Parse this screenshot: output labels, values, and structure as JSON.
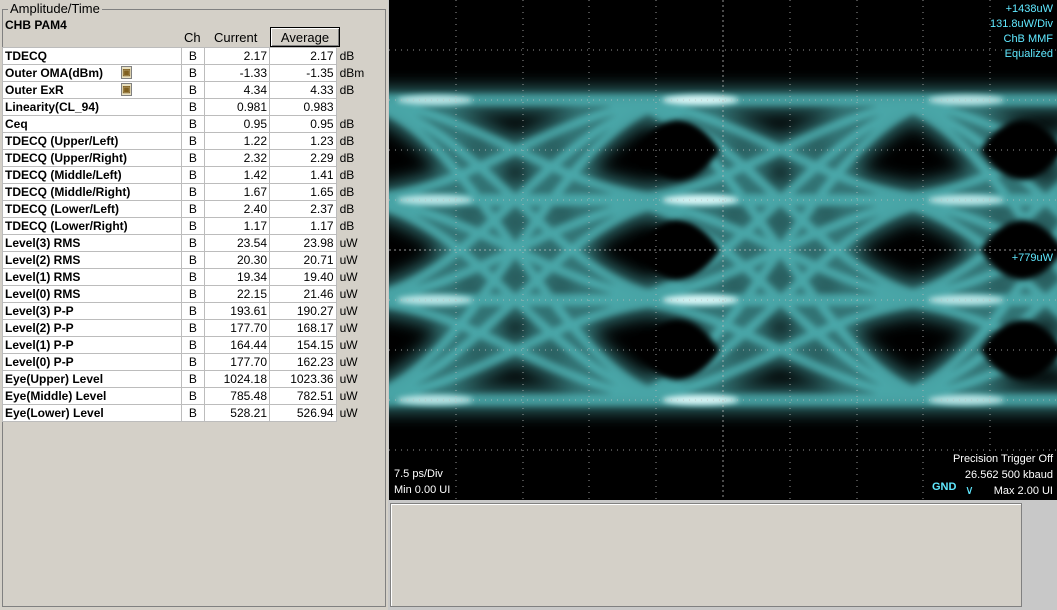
{
  "panel": {
    "title": "Amplitude/Time",
    "subtitle": "CHB PAM4",
    "col_ch": "Ch",
    "col_current": "Current",
    "average_button": "Average",
    "rows": [
      {
        "name": "TDECQ",
        "ch": "B",
        "current": "2.17",
        "average": "2.17",
        "unit": "dB",
        "lock": false
      },
      {
        "name": "Outer OMA(dBm)",
        "ch": "B",
        "current": "-1.33",
        "average": "-1.35",
        "unit": "dBm",
        "lock": true
      },
      {
        "name": "Outer ExR",
        "ch": "B",
        "current": "4.34",
        "average": "4.33",
        "unit": "dB",
        "lock": true
      },
      {
        "name": "Linearity(CL_94)",
        "ch": "B",
        "current": "0.981",
        "average": "0.983",
        "unit": "",
        "lock": false
      },
      {
        "name": "Ceq",
        "ch": "B",
        "current": "0.95",
        "average": "0.95",
        "unit": "dB",
        "lock": false
      },
      {
        "name": "TDECQ (Upper/Left)",
        "ch": "B",
        "current": "1.22",
        "average": "1.23",
        "unit": "dB",
        "lock": false
      },
      {
        "name": "TDECQ (Upper/Right)",
        "ch": "B",
        "current": "2.32",
        "average": "2.29",
        "unit": "dB",
        "lock": false
      },
      {
        "name": "TDECQ (Middle/Left)",
        "ch": "B",
        "current": "1.42",
        "average": "1.41",
        "unit": "dB",
        "lock": false
      },
      {
        "name": "TDECQ (Middle/Right)",
        "ch": "B",
        "current": "1.67",
        "average": "1.65",
        "unit": "dB",
        "lock": false
      },
      {
        "name": "TDECQ (Lower/Left)",
        "ch": "B",
        "current": "2.40",
        "average": "2.37",
        "unit": "dB",
        "lock": false
      },
      {
        "name": "TDECQ (Lower/Right)",
        "ch": "B",
        "current": "1.17",
        "average": "1.17",
        "unit": "dB",
        "lock": false
      },
      {
        "name": "Level(3) RMS",
        "ch": "B",
        "current": "23.54",
        "average": "23.98",
        "unit": "uW",
        "lock": false
      },
      {
        "name": "Level(2) RMS",
        "ch": "B",
        "current": "20.30",
        "average": "20.71",
        "unit": "uW",
        "lock": false
      },
      {
        "name": "Level(1) RMS",
        "ch": "B",
        "current": "19.34",
        "average": "19.40",
        "unit": "uW",
        "lock": false
      },
      {
        "name": "Level(0) RMS",
        "ch": "B",
        "current": "22.15",
        "average": "21.46",
        "unit": "uW",
        "lock": false
      },
      {
        "name": "Level(3) P-P",
        "ch": "B",
        "current": "193.61",
        "average": "190.27",
        "unit": "uW",
        "lock": false
      },
      {
        "name": "Level(2) P-P",
        "ch": "B",
        "current": "177.70",
        "average": "168.17",
        "unit": "uW",
        "lock": false
      },
      {
        "name": "Level(1) P-P",
        "ch": "B",
        "current": "164.44",
        "average": "154.15",
        "unit": "uW",
        "lock": false
      },
      {
        "name": "Level(0) P-P",
        "ch": "B",
        "current": "177.70",
        "average": "162.23",
        "unit": "uW",
        "lock": false
      },
      {
        "name": "Eye(Upper)  Level",
        "ch": "B",
        "current": "1024.18",
        "average": "1023.36",
        "unit": "uW",
        "lock": false
      },
      {
        "name": "Eye(Middle) Level",
        "ch": "B",
        "current": "785.48",
        "average": "782.51",
        "unit": "uW",
        "lock": false
      },
      {
        "name": "Eye(Lower)  Level",
        "ch": "B",
        "current": "528.21",
        "average": "526.94",
        "unit": "uW",
        "lock": false
      }
    ]
  },
  "scope": {
    "top_right": [
      "+1438uW",
      "131.8uW/Div",
      "ChB  MMF",
      "Equalized"
    ],
    "mid_label": "+779uW",
    "timebase": "7.5 ps/Div",
    "min_ui": "Min 0.00 UI",
    "precision": "Precision Trigger Off",
    "rate": "26.562 500 kbaud",
    "max_ui": "Max 2.00 UI",
    "gnd": "GND",
    "trace_color": "#5fd7d9",
    "text_color": "#60e8ff"
  }
}
